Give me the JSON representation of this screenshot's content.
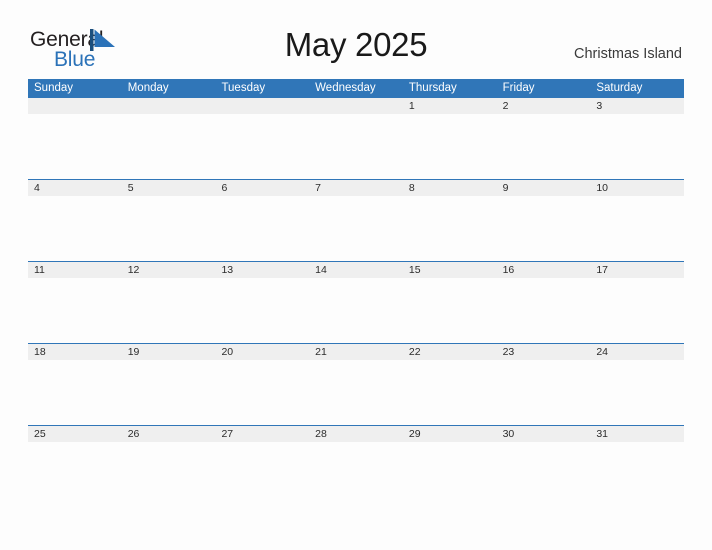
{
  "brand": {
    "name_part1": "General",
    "name_part2": "Blue",
    "mark_icon": "flag-triangle-icon",
    "accent_color": "#2b72b8"
  },
  "header": {
    "title": "May 2025",
    "subtitle": "Christmas Island"
  },
  "calendar": {
    "header_bg": "#3076b8",
    "date_band_bg": "#efefef",
    "weekdays": [
      "Sunday",
      "Monday",
      "Tuesday",
      "Wednesday",
      "Thursday",
      "Friday",
      "Saturday"
    ],
    "weeks": [
      [
        "",
        "",
        "",
        "",
        "1",
        "2",
        "3"
      ],
      [
        "4",
        "5",
        "6",
        "7",
        "8",
        "9",
        "10"
      ],
      [
        "11",
        "12",
        "13",
        "14",
        "15",
        "16",
        "17"
      ],
      [
        "18",
        "19",
        "20",
        "21",
        "22",
        "23",
        "24"
      ],
      [
        "25",
        "26",
        "27",
        "28",
        "29",
        "30",
        "31"
      ]
    ]
  }
}
